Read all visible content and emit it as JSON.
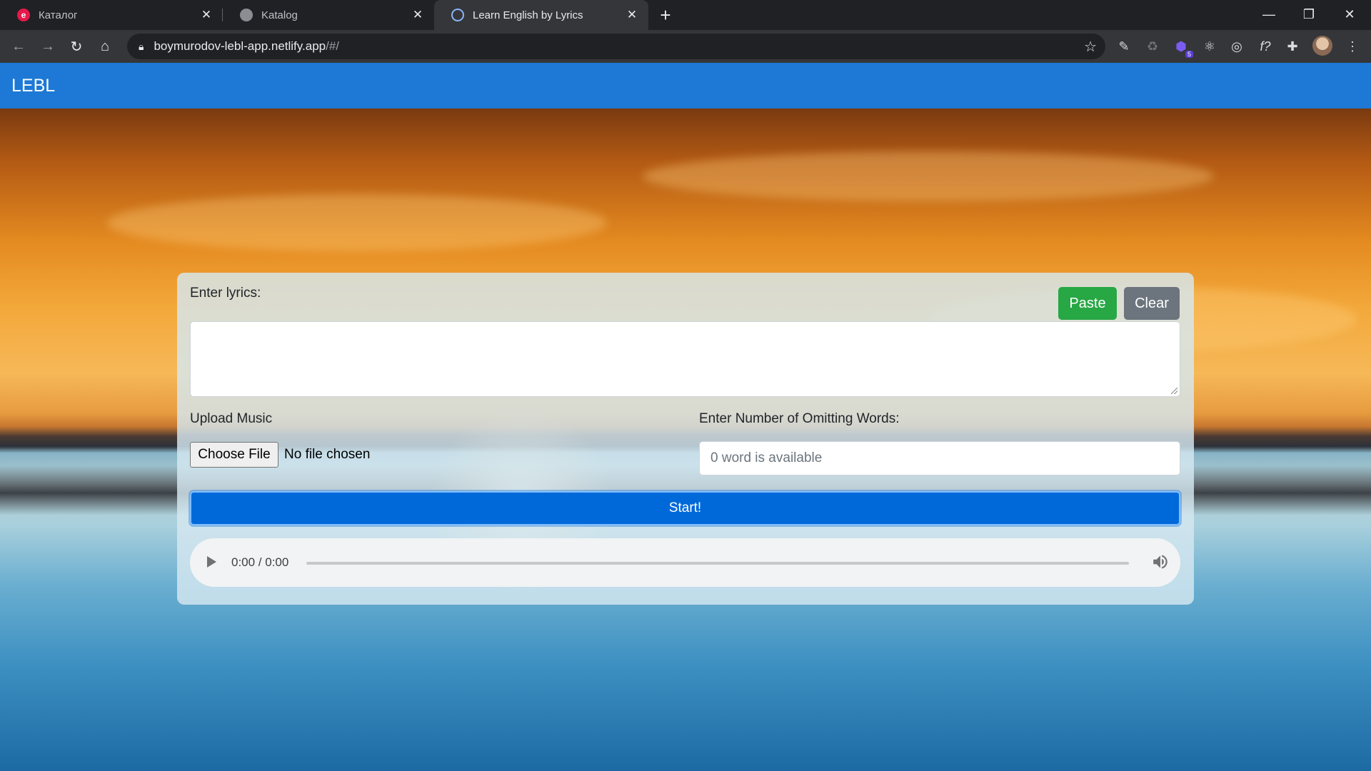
{
  "browser": {
    "tabs": [
      {
        "title": "Каталог",
        "active": false,
        "favicon": "e-letter-icon",
        "favicon_color": "#e8174b"
      },
      {
        "title": "Katalog",
        "active": false,
        "favicon": "globe-icon",
        "favicon_color": "#8a8d91"
      },
      {
        "title": "Learn English by Lyrics",
        "active": true,
        "favicon": "web-icon",
        "favicon_color": "#8ab4f8"
      }
    ],
    "url_host": "boymurodov-lebl-app.netlify.app",
    "url_path": "/#/",
    "extensions": [
      "pen-icon",
      "recycle-icon",
      "shield-icon",
      "atom-icon",
      "target-icon",
      "function-icon",
      "puzzle-icon"
    ],
    "extension_badge": "5",
    "colors": {
      "chrome_dark": "#202124",
      "chrome_toolbar": "#35363a"
    }
  },
  "app": {
    "brand": "LEBL",
    "colors": {
      "navbar": "#1d79d5",
      "paste": "#28a745",
      "clear": "#6c757d",
      "start": "#0069d9"
    },
    "form": {
      "lyrics_label": "Enter lyrics:",
      "paste_label": "Paste",
      "clear_label": "Clear",
      "lyrics_value": "",
      "upload_label": "Upload Music",
      "choose_file_label": "Choose File",
      "file_status": "No file chosen",
      "omit_label": "Enter Number of Omitting Words:",
      "omit_placeholder": "0 word is available",
      "start_label": "Start!"
    },
    "player": {
      "time": "0:00 / 0:00",
      "progress": 0
    }
  }
}
